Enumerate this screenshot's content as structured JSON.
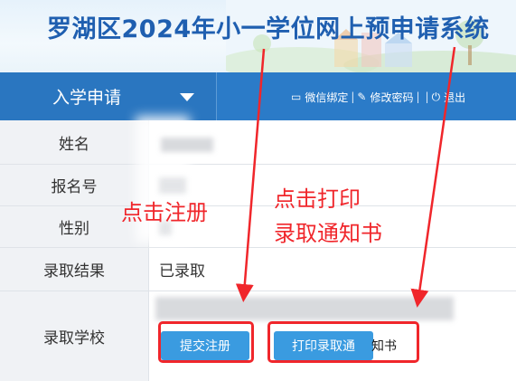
{
  "banner": {
    "title": "罗湖区2024年小一学位网上预申请系统"
  },
  "nav": {
    "dropdown_label": "入学申请",
    "links": [
      {
        "icon": "wechat-bind-icon",
        "glyph": "▭",
        "label": "微信绑定"
      },
      {
        "icon": "pencil-icon",
        "glyph": "✎",
        "label": "修改密码"
      },
      {
        "icon": "power-icon",
        "glyph": "⏻",
        "label": "退出"
      }
    ],
    "separator": "|"
  },
  "form": {
    "rows": [
      {
        "label": "姓名",
        "value": ""
      },
      {
        "label": "报名号",
        "value": ""
      },
      {
        "label": "性别",
        "value": ""
      },
      {
        "label": "录取结果",
        "value": "已录取"
      },
      {
        "label": "录取学校",
        "value": ""
      }
    ]
  },
  "buttons": {
    "register": "提交注册",
    "print": "打印录取通",
    "print_tail": "知书"
  },
  "annotations": {
    "register_hint": "点击注册",
    "print_hint_line1": "点击打印",
    "print_hint_line2": "录取通知书"
  },
  "colors": {
    "nav_bg": "#2b7bc8",
    "button_bg": "#3a9be0",
    "annotation_red": "#f0262b",
    "title_blue": "#1f5fb0"
  }
}
